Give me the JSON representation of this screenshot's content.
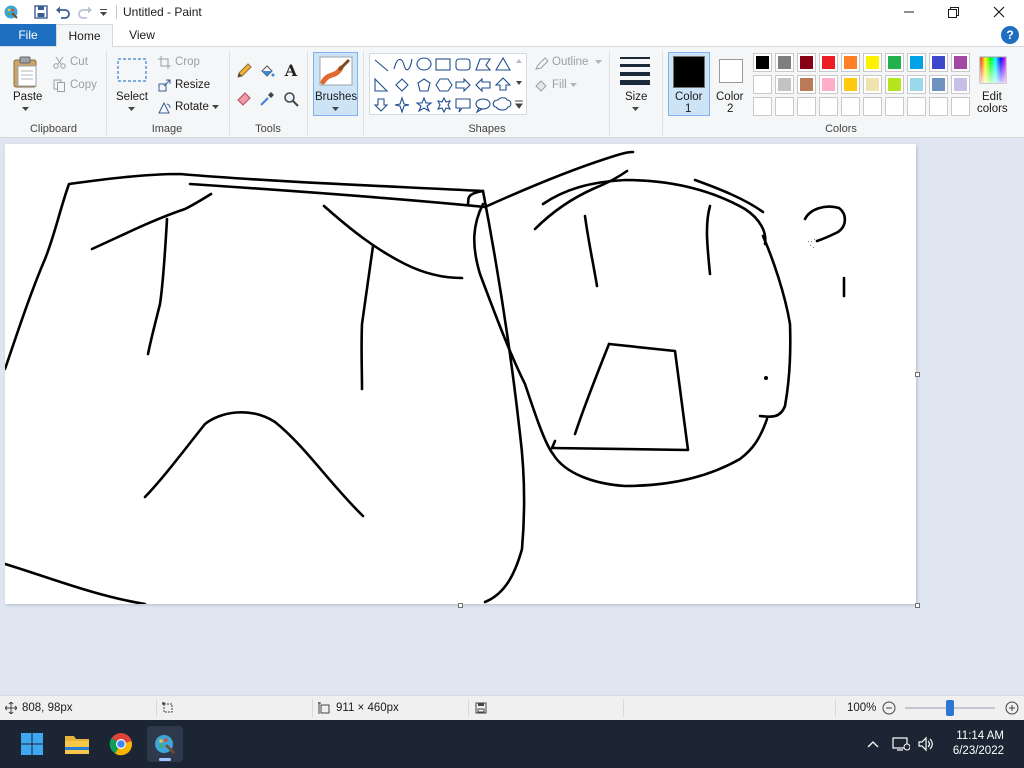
{
  "window": {
    "title": "Untitled - Paint"
  },
  "menu": {
    "file": "File",
    "home": "Home",
    "view": "View",
    "help": "?"
  },
  "clipboard": {
    "paste": "Paste",
    "cut": "Cut",
    "copy": "Copy",
    "label": "Clipboard"
  },
  "image": {
    "select": "Select",
    "crop": "Crop",
    "resize": "Resize",
    "rotate": "Rotate",
    "label": "Image"
  },
  "tools": {
    "label": "Tools",
    "text_glyph": "A"
  },
  "brushes": {
    "label": "Brushes"
  },
  "shapes": {
    "label": "Shapes",
    "outline": "Outline",
    "fill": "Fill"
  },
  "size": {
    "label": "Size"
  },
  "colors": {
    "color1_line1": "Color",
    "color1_line2": "1",
    "color2_line1": "Color",
    "color2_line2": "2",
    "label": "Colors",
    "edit_line1": "Edit",
    "edit_line2": "colors",
    "color1_value": "#000000",
    "color2_value": "#ffffff",
    "palette_row1": [
      "#000000",
      "#7f7f7f",
      "#880015",
      "#ed1c24",
      "#ff7f27",
      "#fff200",
      "#22b14c",
      "#00a2e8",
      "#3f48cc",
      "#a349a4"
    ],
    "palette_row2": [
      "#ffffff",
      "#c3c3c3",
      "#b97a57",
      "#ffaec9",
      "#ffc90e",
      "#efe4b0",
      "#b5e61d",
      "#99d9ea",
      "#7092be",
      "#c8bfe7"
    ],
    "palette_row3": [
      "#ffffff",
      "#ffffff",
      "#ffffff",
      "#ffffff",
      "#ffffff",
      "#ffffff",
      "#ffffff",
      "#ffffff",
      "#ffffff",
      "#ffffff"
    ]
  },
  "status": {
    "cursor_pos": "808, 98px",
    "canvas_size": "911 × 460px",
    "zoom": "100%",
    "zoom_fraction": 0.5
  },
  "taskbar": {
    "time": "11:14 AM",
    "date": "6/23/2022"
  }
}
